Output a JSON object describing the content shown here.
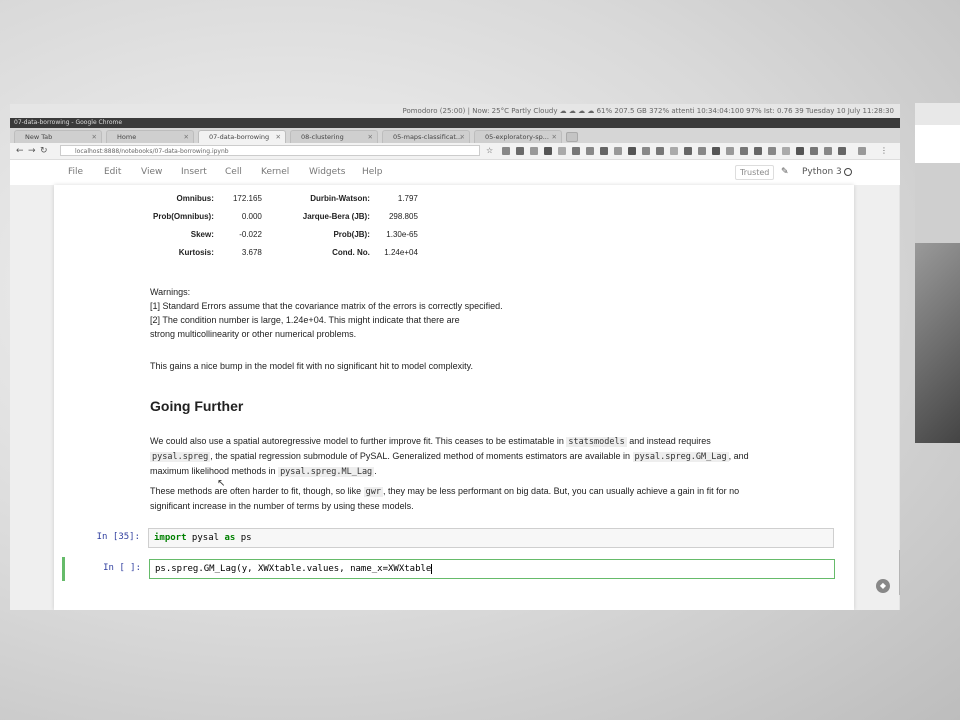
{
  "system_bar": {
    "left": "",
    "text": "Pomodoro (25:00)  |  Now:  25°C Partly Cloudy  ☁ ☁ ☁ ☁  61%  207.5 GB  372%  attenti 10:34:04:100  97%  Ist: 0.76  39  Tuesday 10 July  11:28:30"
  },
  "window_title": "07-data-borrowing - Google Chrome",
  "tabs": [
    {
      "label": "New Tab"
    },
    {
      "label": "Home"
    },
    {
      "label": "07-data-borrowing"
    },
    {
      "label": "08-clustering"
    },
    {
      "label": "05-maps-classificat..."
    },
    {
      "label": "05-exploratory-sp..."
    }
  ],
  "address": {
    "url": "localhost:8888/notebooks/07-data-borrowing.ipynb"
  },
  "menu": {
    "file": "File",
    "edit": "Edit",
    "view": "View",
    "insert": "Insert",
    "cell": "Cell",
    "kernel": "Kernel",
    "widgets": "Widgets",
    "help": "Help",
    "trusted": "Trusted",
    "kernel_name": "Python 3"
  },
  "stats": [
    {
      "k1": "Omnibus:",
      "v1": "172.165",
      "k2": "Durbin-Watson:",
      "v2": "1.797"
    },
    {
      "k1": "Prob(Omnibus):",
      "v1": "0.000",
      "k2": "Jarque-Bera (JB):",
      "v2": "298.805"
    },
    {
      "k1": "Skew:",
      "v1": "-0.022",
      "k2": "Prob(JB):",
      "v2": "1.30e-65"
    },
    {
      "k1": "Kurtosis:",
      "v1": "3.678",
      "k2": "Cond. No.",
      "v2": "1.24e+04"
    }
  ],
  "warnings": {
    "title": "Warnings:",
    "line1": "[1] Standard Errors assume that the covariance matrix of the errors is correctly specified.",
    "line2": "[2] The condition number is large, 1.24e+04. This might indicate that there are",
    "line3": "strong multicollinearity or other numerical problems."
  },
  "bump_text": "This gains a nice bump in the model fit with no significant hit to model complexity.",
  "heading": "Going Further",
  "para1": {
    "a": "We could also use a spatial autoregressive model to further improve fit. This ceases to be estimatable in ",
    "code1": "statsmodels",
    "b": " and instead requires",
    "code2": "pysal.spreg",
    "c": ", the spatial regression submodule of PySAL. Generalized method of moments estimators are available in ",
    "code3": "pysal.spreg.GM_Lag",
    "d": ", and",
    "e": "maximum likelihood methods in ",
    "code4": "pysal.spreg.ML_Lag",
    "f": "."
  },
  "para2": {
    "a": "These methods are often harder to fit, though, so like ",
    "code1": "gwr",
    "b": ", they may be less performant on big data. But, you can usually achieve a gain in fit for no",
    "c": "significant increase in the number of terms by using these models."
  },
  "cells": [
    {
      "prompt": "In [35]:",
      "kw_import": "import",
      "rest": " pysal ",
      "kw_as": "as",
      "rest2": " ps"
    },
    {
      "prompt": "In [ ]:",
      "code": "ps.spreg.GM_Lag(y, XWXtable.values, name_x=XWXtable"
    }
  ]
}
